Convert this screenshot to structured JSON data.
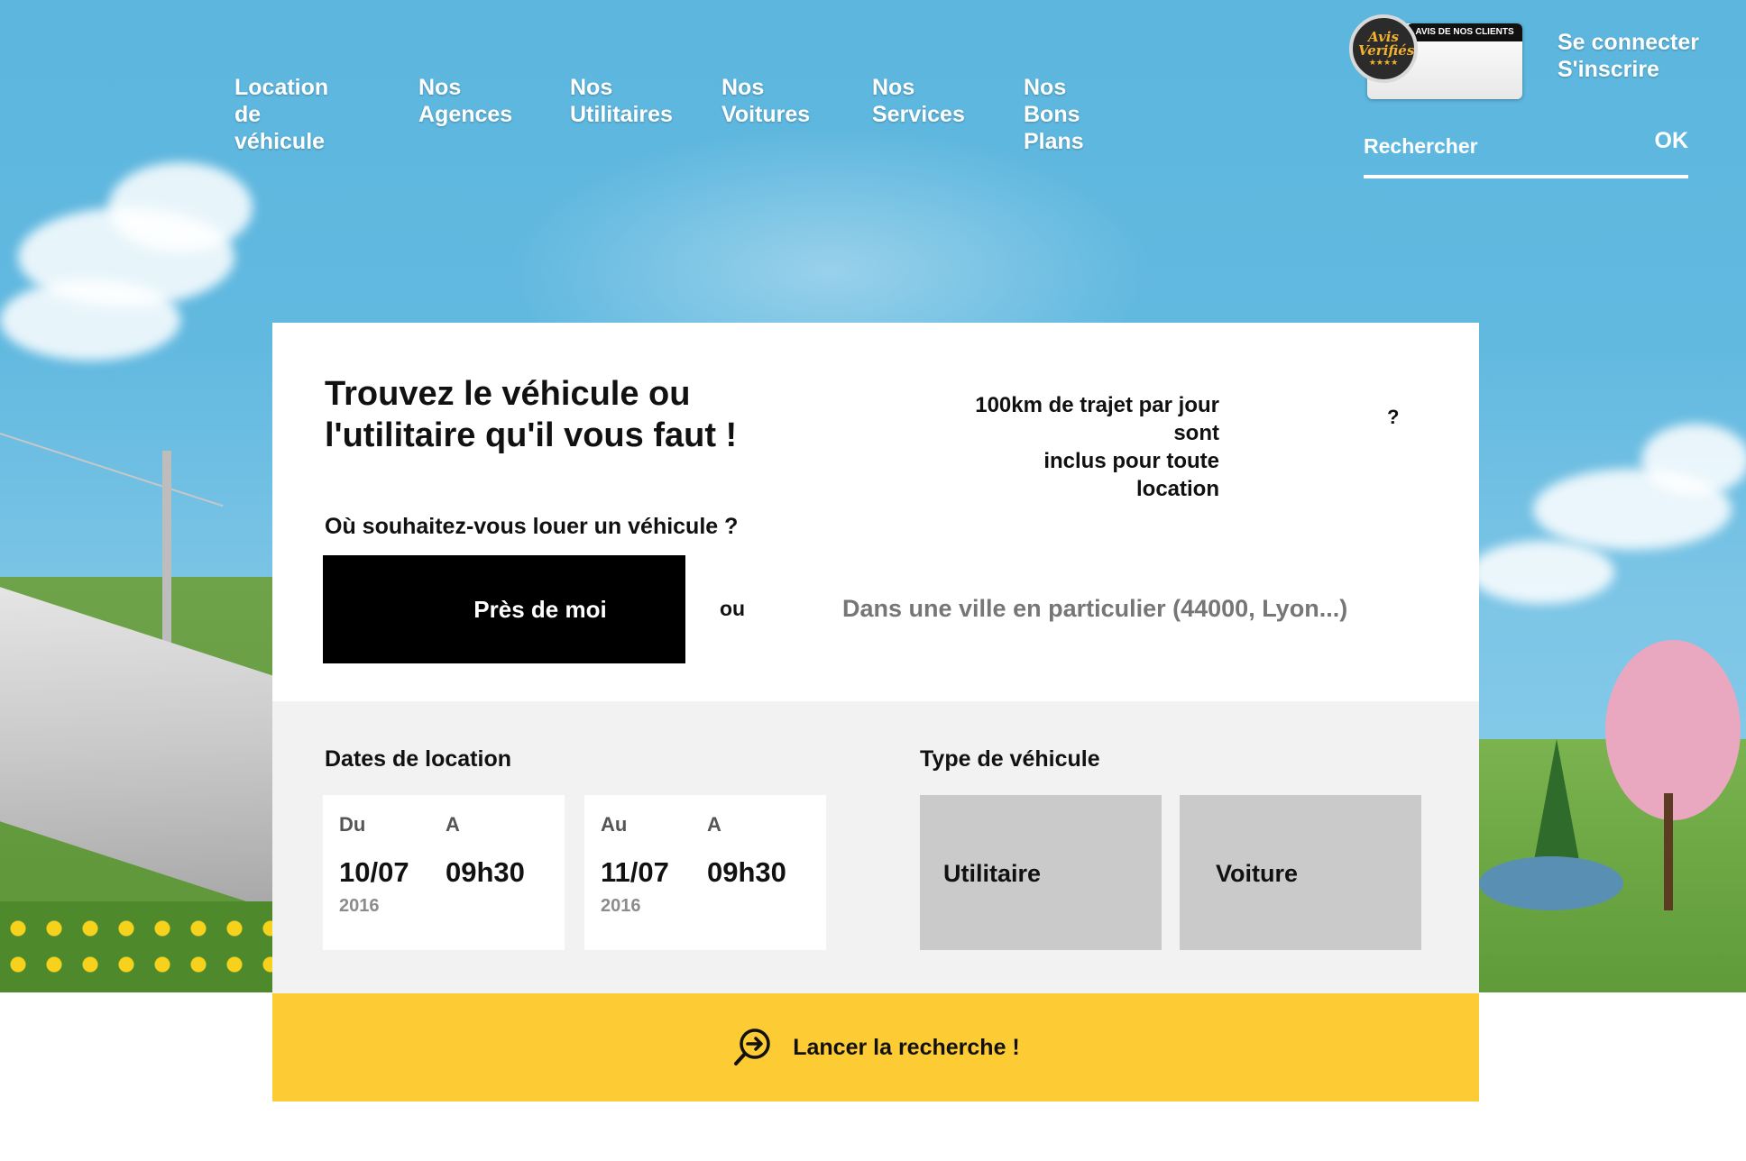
{
  "nav": {
    "items": [
      {
        "label": "Location de\nvéhicule"
      },
      {
        "label": "Nos\nAgences"
      },
      {
        "label": "Nos\nUtilitaires"
      },
      {
        "label": "Nos\nVoitures"
      },
      {
        "label": "Nos\nServices"
      },
      {
        "label": "Nos\nBons Plans"
      }
    ]
  },
  "badge": {
    "seal_text": "Avis Verifiés",
    "strip_text": "AVIS DE NOS CLIENTS",
    "icon": "verified-reviews-seal-icon"
  },
  "account": {
    "login_label": "Se connecter",
    "signup_label": "S'inscrire"
  },
  "search": {
    "placeholder": "Rechercher",
    "submit_label": "OK"
  },
  "booking": {
    "headline": "Trouvez le véhicule ou\nl'utilitaire qu'il vous faut !",
    "km_note": "100km de trajet par jour sont\ninclus pour toute location",
    "help_label": "?",
    "location_question": "Où souhaitez-vous louer un véhicule ?",
    "near_me_label": "Près de moi",
    "or_label": "ou",
    "city_placeholder": "Dans une ville en particulier (44000, Lyon...)",
    "dates_label": "Dates de location",
    "start": {
      "day_head": "Du",
      "time_head": "A",
      "date": "10/07",
      "year": "2016",
      "time": "09h30"
    },
    "end": {
      "day_head": "Au",
      "time_head": "A",
      "date": "11/07",
      "year": "2016",
      "time": "09h30"
    },
    "type_label": "Type de véhicule",
    "types": [
      {
        "label": "Utilitaire"
      },
      {
        "label": "Voiture"
      }
    ],
    "cta_label": "Lancer la recherche !",
    "cta_icon": "magnifier-arrow-icon"
  },
  "colors": {
    "sky": "#5cb6de",
    "cta": "#fdcb33",
    "near_me_button": "#000000",
    "type_tile": "#cacaca",
    "dates_section": "#f2f2f2"
  }
}
